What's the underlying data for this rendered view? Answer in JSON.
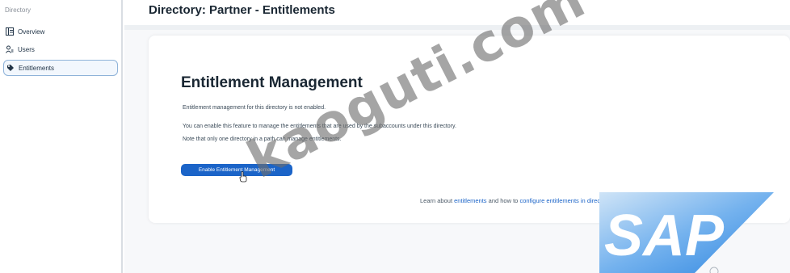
{
  "sidebar": {
    "heading": "Directory",
    "items": [
      {
        "label": "Overview",
        "icon": "overview-icon",
        "active": false
      },
      {
        "label": "Users",
        "icon": "users-icon",
        "active": false
      },
      {
        "label": "Entitlements",
        "icon": "entitlements-icon",
        "active": true
      }
    ]
  },
  "header": {
    "title": "Directory: Partner - Entitlements"
  },
  "card": {
    "title": "Entitlement Management",
    "paragraphs": [
      "Entitlement management for this directory is not enabled.",
      "You can enable this feature to manage the entitlements that are used by the subaccounts under this directory.",
      "Note that only one directory in a path can manage entitlements."
    ],
    "button_label": "Enable Entitlement Management",
    "learn": {
      "prefix": "Learn about ",
      "link1": "entitlements",
      "middle": " and how to ",
      "link2": "configure entitlements in directories",
      "suffix": "."
    }
  },
  "watermark": "kaoguti.com",
  "logo": {
    "text": "SAP",
    "colors": {
      "light": "#b9d8f2",
      "mid": "#6aaef0",
      "dark": "#2f86e0"
    }
  },
  "colors": {
    "accent": "#1b64c8",
    "active_border": "#8fb3d9"
  }
}
